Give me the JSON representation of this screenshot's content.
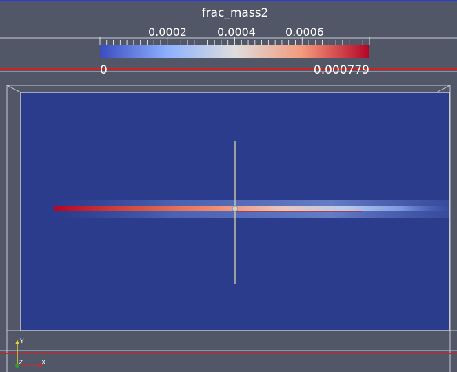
{
  "viewport": {
    "background": "#525768",
    "domain_color": "#2c3c8c",
    "frame_color": "#c9cbd4",
    "outline_color": "#cc2222",
    "probe_line_color": "#e0e0a0"
  },
  "color_legend": {
    "title": "frac_mass2",
    "min_label": "0",
    "max_label": "0.000779",
    "tick_labels": [
      "0.0002",
      "0.0004",
      "0.0006"
    ],
    "colormap": [
      "#3b4cc0",
      "#8db0fe",
      "#dddddd",
      "#f49a7b",
      "#b40426"
    ]
  },
  "orientation_axes": {
    "x_label": "X",
    "y_label": "Y",
    "z_label": "Z",
    "x_color": "#d62728",
    "y_color": "#e8d020",
    "z_color": "#2ca02c"
  },
  "field": {
    "name": "frac_mass2",
    "range": [
      0,
      0.000779
    ]
  }
}
